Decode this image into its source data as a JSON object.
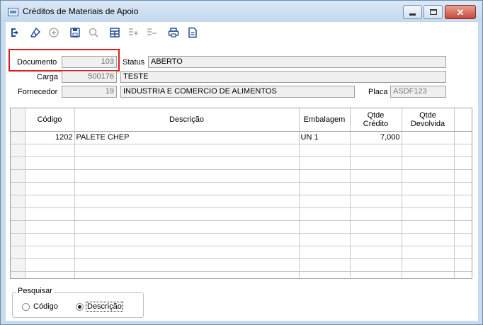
{
  "window": {
    "title": "Créditos de Materiais de Apoio",
    "min_glyph": "minimize-icon",
    "close_glyph": "✕"
  },
  "toolbar": {
    "buttons": [
      {
        "name": "exit-icon",
        "enabled": true
      },
      {
        "name": "eraser-icon",
        "enabled": true
      },
      {
        "name": "add-icon",
        "enabled": false
      },
      {
        "name": "save-icon",
        "enabled": true
      },
      {
        "name": "search-icon",
        "enabled": false
      },
      {
        "name": "grid-icon",
        "enabled": true
      },
      {
        "name": "add-row-icon",
        "enabled": false
      },
      {
        "name": "remove-row-icon",
        "enabled": false
      },
      {
        "name": "print-icon",
        "enabled": true
      },
      {
        "name": "document-icon",
        "enabled": true
      }
    ]
  },
  "form": {
    "documento_label": "Documento",
    "documento_value": "103",
    "status_label": "Status",
    "status_value": "ABERTO",
    "carga_label": "Carga",
    "carga_value": "500176",
    "carga_desc": "TESTE",
    "fornecedor_label": "Fornecedor",
    "fornecedor_value": "19",
    "fornecedor_desc": "INDUSTRIA E COMERCIO DE ALIMENTOS",
    "placa_label": "Placa",
    "placa_value": "ASDF123"
  },
  "grid": {
    "headers": {
      "codigo": "Código",
      "descricao": "Descrição",
      "embalagem": "Embalagem",
      "qtde_credito_1": "Qtde",
      "qtde_credito_2": "Crédito",
      "qtde_devolvida_1": "Qtde",
      "qtde_devolvida_2": "Devolvida"
    },
    "rows": [
      {
        "codigo": "1202",
        "descricao": "PALETE CHEP",
        "embalagem": "UN 1",
        "qtde_credito": "7,000",
        "qtde_devolvida": ""
      }
    ],
    "empty_rows": 11
  },
  "search": {
    "legend": "Pesquisar",
    "option_codigo": "Código",
    "option_descricao": "Descrição",
    "selected": "Descrição"
  },
  "colors": {
    "highlight": "#e01b1b",
    "close_button": "#c9483b",
    "toolbar_icon": "#1f4f8f"
  }
}
